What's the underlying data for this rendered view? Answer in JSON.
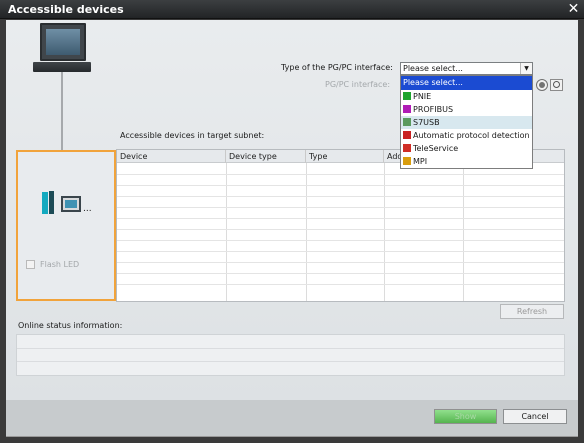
{
  "window": {
    "title": "Accessible devices",
    "close_symbol": "✕"
  },
  "interface": {
    "type_label": "Type of the PG/PC interface:",
    "type_value": "Please select...",
    "pgpc_label": "PG/PC interface:",
    "options": [
      {
        "label": "Please select...",
        "icon": null,
        "color": null
      },
      {
        "label": "PNIE",
        "icon": "network-green-icon",
        "color": "#1ea52e"
      },
      {
        "label": "PROFIBUS",
        "icon": "network-purple-icon",
        "color": "#b01cb6"
      },
      {
        "label": "S7USB",
        "icon": "usb-icon",
        "color": "#5a9a5e"
      },
      {
        "label": "Automatic protocol detection",
        "icon": "network-red-icon",
        "color": "#c92121"
      },
      {
        "label": "TeleService",
        "icon": "network-red-icon",
        "color": "#d02e26"
      },
      {
        "label": "MPI",
        "icon": "network-yellow-icon",
        "color": "#d99d0d"
      }
    ]
  },
  "subnet": {
    "title": "Accessible devices in target subnet:",
    "columns": [
      "Device",
      "Device type",
      "Type",
      "Add",
      "",
      ""
    ],
    "flash_led_label": "Flash LED"
  },
  "status": {
    "label": "Online status information:"
  },
  "buttons": {
    "refresh": "Refresh",
    "show": "Show",
    "cancel": "Cancel"
  },
  "colors": {
    "device_border": "#f1a33b",
    "dropdown_highlight": "#1b4bd2",
    "hover_row": "#d8e8ef",
    "show_button": "#55b44f"
  }
}
